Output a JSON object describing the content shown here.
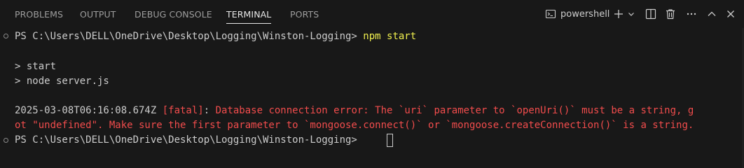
{
  "tabs": [
    {
      "label": "PROBLEMS"
    },
    {
      "label": "OUTPUT"
    },
    {
      "label": "DEBUG CONSOLE"
    },
    {
      "label": "TERMINAL",
      "active": true
    },
    {
      "label": "PORTS"
    }
  ],
  "toolbar": {
    "shell_label": "powershell",
    "icons": [
      "terminal-icon",
      "plus-icon",
      "chevron-down-icon",
      "split-icon",
      "trash-icon",
      "ellipsis-icon",
      "chevron-up-icon",
      "close-icon"
    ]
  },
  "terminal": {
    "prompt1": "PS C:\\Users\\DELL\\OneDrive\\Desktop\\Logging\\Winston-Logging> ",
    "command1": "npm start",
    "line_start": "> start",
    "line_node": "> node server.js",
    "err_timestamp": "2025-03-08T06:16:08.674Z ",
    "err_level": "[fatal]",
    "err_colon": ": ",
    "err_msg1": "Database connection error: The `uri` parameter to `openUri()` must be a string, g",
    "err_msg2": "ot \"undefined\". Make sure the first parameter to `mongoose.connect()` or `mongoose.createConnection()` is a string.",
    "prompt2": "PS C:\\Users\\DELL\\OneDrive\\Desktop\\Logging\\Winston-Logging> "
  },
  "colors": {
    "background": "#181818",
    "command": "#f1f04f",
    "error": "#f14c4c",
    "text": "#cccccc"
  }
}
